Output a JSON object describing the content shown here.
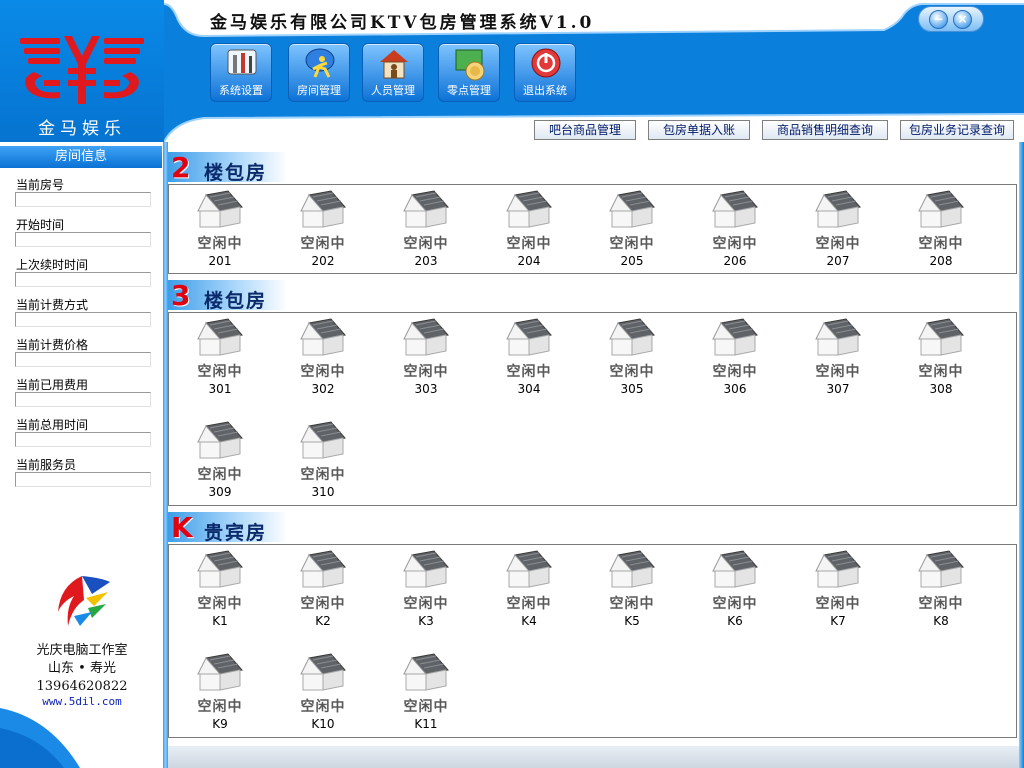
{
  "brand": {
    "logo_text": "金马娱乐",
    "accent": "#0b7fdc",
    "logo_red": "#e0191e"
  },
  "header": {
    "title": "金马娱乐有限公司KTV包房管理系统V1.0",
    "toolbar": [
      {
        "id": "settings",
        "label": "系统设置",
        "icon": "tools-icon"
      },
      {
        "id": "rooms",
        "label": "房间管理",
        "icon": "running-person-icon"
      },
      {
        "id": "staff",
        "label": "人员管理",
        "icon": "house-person-icon"
      },
      {
        "id": "snacks",
        "label": "零点管理",
        "icon": "food-plate-icon"
      },
      {
        "id": "exit",
        "label": "退出系统",
        "icon": "power-icon"
      }
    ],
    "quick_links": [
      "吧台商品管理",
      "包房单据入账",
      "商品销售明细查询",
      "包房业务记录查询"
    ]
  },
  "sidebar": {
    "header": "房间信息",
    "fields": [
      {
        "label": "当前房号",
        "value": ""
      },
      {
        "label": "开始时间",
        "value": ""
      },
      {
        "label": "上次续时时间",
        "value": ""
      },
      {
        "label": "当前计费方式",
        "value": ""
      },
      {
        "label": "当前计费价格",
        "value": ""
      },
      {
        "label": "当前已用费用",
        "value": ""
      },
      {
        "label": "当前总用时间",
        "value": ""
      },
      {
        "label": "当前服务员",
        "value": ""
      }
    ],
    "studio": {
      "name": "光庆电脑工作室",
      "location": "山东 • 寿光",
      "phone": "13964620822",
      "url": "www.5dil.com"
    }
  },
  "floors": [
    {
      "badge": "2",
      "title": "楼包房",
      "rooms": [
        {
          "no": "201",
          "status": "空闲中"
        },
        {
          "no": "202",
          "status": "空闲中"
        },
        {
          "no": "203",
          "status": "空闲中"
        },
        {
          "no": "204",
          "status": "空闲中"
        },
        {
          "no": "205",
          "status": "空闲中"
        },
        {
          "no": "206",
          "status": "空闲中"
        },
        {
          "no": "207",
          "status": "空闲中"
        },
        {
          "no": "208",
          "status": "空闲中"
        }
      ]
    },
    {
      "badge": "3",
      "title": "楼包房",
      "rooms": [
        {
          "no": "301",
          "status": "空闲中"
        },
        {
          "no": "302",
          "status": "空闲中"
        },
        {
          "no": "303",
          "status": "空闲中"
        },
        {
          "no": "304",
          "status": "空闲中"
        },
        {
          "no": "305",
          "status": "空闲中"
        },
        {
          "no": "306",
          "status": "空闲中"
        },
        {
          "no": "307",
          "status": "空闲中"
        },
        {
          "no": "308",
          "status": "空闲中"
        },
        {
          "no": "309",
          "status": "空闲中"
        },
        {
          "no": "310",
          "status": "空闲中"
        }
      ]
    },
    {
      "badge": "K",
      "title": "贵宾房",
      "rooms": [
        {
          "no": "K1",
          "status": "空闲中"
        },
        {
          "no": "K2",
          "status": "空闲中"
        },
        {
          "no": "K3",
          "status": "空闲中"
        },
        {
          "no": "K4",
          "status": "空闲中"
        },
        {
          "no": "K5",
          "status": "空闲中"
        },
        {
          "no": "K6",
          "status": "空闲中"
        },
        {
          "no": "K7",
          "status": "空闲中"
        },
        {
          "no": "K8",
          "status": "空闲中"
        },
        {
          "no": "K9",
          "status": "空闲中"
        },
        {
          "no": "K10",
          "status": "空闲中"
        },
        {
          "no": "K11",
          "status": "空闲中"
        }
      ]
    }
  ]
}
